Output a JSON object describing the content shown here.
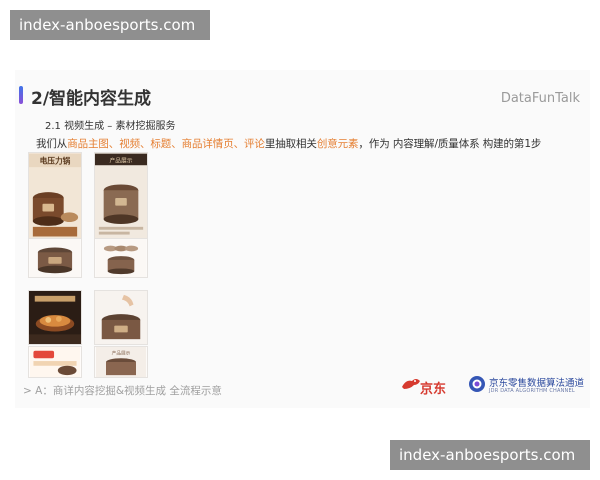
{
  "watermark": {
    "top": "index-anboesports.com",
    "bottom": "index-anboesports.com"
  },
  "slide": {
    "title": "2/智能内容生成",
    "brand": "DataFunTalk",
    "section": "2.1 视频生成 – 素材挖掘服务",
    "description": {
      "prefix": "我们从",
      "highlight_sources": "商品主图、视频、标题、商品详情页、评论",
      "middle": "里抽取相关",
      "highlight_elements": "创意元素",
      "suffix": "，作为 内容理解/质量体系 构建的第1步"
    },
    "caption": "> A：商详内容挖掘&视频生成 全流程示意",
    "logos": {
      "jd": "京东",
      "lab_name": "京东零售数据算法通道",
      "lab_english": "JDR DATA ALGORITHM CHANNEL"
    }
  },
  "thumbnails": [
    {
      "name": "product-main-image",
      "label": "电压力锅",
      "icon": "pressure-cooker"
    },
    {
      "name": "product-detail-image",
      "label": "产品展示",
      "icon": "pressure-cooker"
    },
    {
      "name": "product-feature-image",
      "label": "",
      "icon": "cooker-lid"
    },
    {
      "name": "product-angle-image",
      "label": "",
      "icon": "cooker-set"
    },
    {
      "name": "food-poster-image",
      "label": "",
      "icon": "food-bowl"
    },
    {
      "name": "hand-demo-image",
      "label": "",
      "icon": "hand"
    },
    {
      "name": "promo-sale-image",
      "label": "",
      "icon": "sale-badge"
    },
    {
      "name": "cooker-closeup-image",
      "label": "产品展示",
      "icon": "pressure-cooker"
    }
  ],
  "colors": {
    "highlight": "#e57f32",
    "accent_top": "#3f74e8",
    "accent_bottom": "#8a4fd8",
    "jd_red": "#d63a2f",
    "lab_blue": "#2c4a9e",
    "watermark_bg": "#8f8f8f"
  }
}
